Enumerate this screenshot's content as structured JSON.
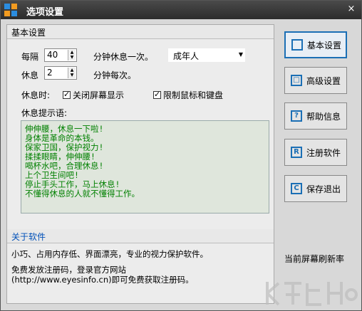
{
  "window": {
    "title": "选项设置",
    "close": "×"
  },
  "basic": {
    "header": "基本设置",
    "every_label": "每隔",
    "interval_value": "40",
    "interval_unit": "分钟休息一次。",
    "rest_label": "休息",
    "rest_value": "2",
    "rest_unit": "分钟每次。",
    "profile_value": "成年人",
    "during_rest_label": "休息时:",
    "check_close_screen": "关闭屏幕显示",
    "check_limit_input": "限制鼠标和键盘",
    "prompt_label": "休息提示语:",
    "messages": [
      "伸伸腰，休息一下啦!",
      "身体是革命的本钱。",
      "保家卫国，保护视力!",
      "揉揉眼睛，伸伸腰!",
      "喝杯水吧，合理休息!",
      "上个卫生间吧!",
      "停止手头工作，马上休息!",
      "不懂得休息的人就不懂得工作。"
    ]
  },
  "about": {
    "header": "关于软件",
    "line1": "小巧、占用内存低、界面漂亮，专业的视力保护软件。",
    "line2": "免费发放注册码，登录官方网站",
    "line3": "(http://www.eyesinfo.cn)即可免费获取注册码。"
  },
  "sidebar": {
    "buttons": [
      {
        "icon": "",
        "label": "基本设置"
      },
      {
        "icon": "□",
        "label": "高级设置"
      },
      {
        "icon": "?",
        "label": "帮助信息"
      },
      {
        "icon": "R",
        "label": "注册软件"
      },
      {
        "icon": "C",
        "label": "保存退出"
      }
    ],
    "refresh_label": "当前屏幕刷新率"
  },
  "colors": {
    "titlebar": "#333333",
    "accent": "#1b6fb5",
    "message_text": "#008000",
    "link": "#0050b8"
  }
}
